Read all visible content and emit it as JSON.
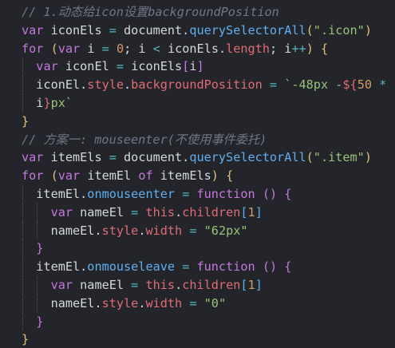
{
  "editor": {
    "lines": [
      [
        {
          "t": "// 1.动态给icon设置backgroundPosition",
          "c": "comment"
        }
      ],
      [
        {
          "t": "var",
          "c": "keyword"
        },
        {
          "t": " iconEls ",
          "c": "plain"
        },
        {
          "t": "=",
          "c": "op"
        },
        {
          "t": " document.",
          "c": "plain"
        },
        {
          "t": "querySelectorAll",
          "c": "method"
        },
        {
          "t": "(",
          "c": "bracket-gold"
        },
        {
          "t": "\".icon\"",
          "c": "string"
        },
        {
          "t": ")",
          "c": "bracket-gold"
        }
      ],
      [
        {
          "t": "for",
          "c": "keyword"
        },
        {
          "t": " ",
          "c": "plain"
        },
        {
          "t": "(",
          "c": "bracket-gold"
        },
        {
          "t": "var",
          "c": "keyword"
        },
        {
          "t": " i ",
          "c": "plain"
        },
        {
          "t": "=",
          "c": "op"
        },
        {
          "t": " ",
          "c": "plain"
        },
        {
          "t": "0",
          "c": "number"
        },
        {
          "t": "; i ",
          "c": "plain"
        },
        {
          "t": "<",
          "c": "op"
        },
        {
          "t": " iconEls.",
          "c": "plain"
        },
        {
          "t": "length",
          "c": "builtin"
        },
        {
          "t": "; i",
          "c": "plain"
        },
        {
          "t": "++",
          "c": "op"
        },
        {
          "t": ")",
          "c": "bracket-gold"
        },
        {
          "t": " ",
          "c": "plain"
        },
        {
          "t": "{",
          "c": "bracket-gold"
        }
      ],
      [
        {
          "t": "  ",
          "c": "plain"
        },
        {
          "t": "var",
          "c": "keyword"
        },
        {
          "t": " iconEl ",
          "c": "plain"
        },
        {
          "t": "=",
          "c": "op"
        },
        {
          "t": " iconEls",
          "c": "plain"
        },
        {
          "t": "[",
          "c": "bracket-purple"
        },
        {
          "t": "i",
          "c": "plain"
        },
        {
          "t": "]",
          "c": "bracket-purple"
        }
      ],
      [
        {
          "t": "  iconEl.",
          "c": "plain"
        },
        {
          "t": "style",
          "c": "builtin"
        },
        {
          "t": ".",
          "c": "plain"
        },
        {
          "t": "backgroundPosition",
          "c": "builtin"
        },
        {
          "t": " ",
          "c": "plain"
        },
        {
          "t": "=",
          "c": "op"
        },
        {
          "t": " ",
          "c": "plain"
        },
        {
          "t": "`-48px -",
          "c": "template"
        },
        {
          "t": "${",
          "c": "template-expr"
        },
        {
          "t": "50",
          "c": "number"
        },
        {
          "t": " ",
          "c": "plain"
        },
        {
          "t": "*",
          "c": "op"
        }
      ],
      [
        {
          "t": "  i",
          "c": "plain"
        },
        {
          "t": "}",
          "c": "template-expr"
        },
        {
          "t": "px`",
          "c": "template"
        }
      ],
      [
        {
          "t": "}",
          "c": "bracket-gold"
        }
      ],
      [
        {
          "t": "// 方案一: mouseenter(不使用事件委托)",
          "c": "comment"
        }
      ],
      [
        {
          "t": "var",
          "c": "keyword"
        },
        {
          "t": " itemEls ",
          "c": "plain"
        },
        {
          "t": "=",
          "c": "op"
        },
        {
          "t": " document.",
          "c": "plain"
        },
        {
          "t": "querySelectorAll",
          "c": "method"
        },
        {
          "t": "(",
          "c": "bracket-gold"
        },
        {
          "t": "\".item\"",
          "c": "string"
        },
        {
          "t": ")",
          "c": "bracket-gold"
        }
      ],
      [
        {
          "t": "for",
          "c": "keyword"
        },
        {
          "t": " ",
          "c": "plain"
        },
        {
          "t": "(",
          "c": "bracket-gold"
        },
        {
          "t": "var",
          "c": "keyword"
        },
        {
          "t": " itemEl ",
          "c": "plain"
        },
        {
          "t": "of",
          "c": "keyword"
        },
        {
          "t": " itemEls",
          "c": "plain"
        },
        {
          "t": ")",
          "c": "bracket-gold"
        },
        {
          "t": " ",
          "c": "plain"
        },
        {
          "t": "{",
          "c": "bracket-gold"
        }
      ],
      [
        {
          "t": "  itemEl.",
          "c": "plain"
        },
        {
          "t": "onmouseenter",
          "c": "method"
        },
        {
          "t": " ",
          "c": "plain"
        },
        {
          "t": "=",
          "c": "op"
        },
        {
          "t": " ",
          "c": "plain"
        },
        {
          "t": "function",
          "c": "keyword"
        },
        {
          "t": " ",
          "c": "plain"
        },
        {
          "t": "()",
          "c": "bracket-purple"
        },
        {
          "t": " ",
          "c": "plain"
        },
        {
          "t": "{",
          "c": "bracket-purple"
        }
      ],
      [
        {
          "t": "    ",
          "c": "plain"
        },
        {
          "t": "var",
          "c": "keyword"
        },
        {
          "t": " nameEl ",
          "c": "plain"
        },
        {
          "t": "=",
          "c": "op"
        },
        {
          "t": " ",
          "c": "plain"
        },
        {
          "t": "this",
          "c": "builtin"
        },
        {
          "t": ".",
          "c": "plain"
        },
        {
          "t": "children",
          "c": "builtin"
        },
        {
          "t": "[",
          "c": "bracket-blue"
        },
        {
          "t": "1",
          "c": "number"
        },
        {
          "t": "]",
          "c": "bracket-blue"
        }
      ],
      [
        {
          "t": "    nameEl.",
          "c": "plain"
        },
        {
          "t": "style",
          "c": "builtin"
        },
        {
          "t": ".",
          "c": "plain"
        },
        {
          "t": "width",
          "c": "builtin"
        },
        {
          "t": " ",
          "c": "plain"
        },
        {
          "t": "=",
          "c": "op"
        },
        {
          "t": " ",
          "c": "plain"
        },
        {
          "t": "\"62px\"",
          "c": "string"
        }
      ],
      [
        {
          "t": "  ",
          "c": "plain"
        },
        {
          "t": "}",
          "c": "bracket-purple"
        }
      ],
      [
        {
          "t": "  itemEl.",
          "c": "plain"
        },
        {
          "t": "onmouseleave",
          "c": "method"
        },
        {
          "t": " ",
          "c": "plain"
        },
        {
          "t": "=",
          "c": "op"
        },
        {
          "t": " ",
          "c": "plain"
        },
        {
          "t": "function",
          "c": "keyword"
        },
        {
          "t": " ",
          "c": "plain"
        },
        {
          "t": "()",
          "c": "bracket-purple"
        },
        {
          "t": " ",
          "c": "plain"
        },
        {
          "t": "{",
          "c": "bracket-purple"
        }
      ],
      [
        {
          "t": "    ",
          "c": "plain"
        },
        {
          "t": "var",
          "c": "keyword"
        },
        {
          "t": " nameEl ",
          "c": "plain"
        },
        {
          "t": "=",
          "c": "op"
        },
        {
          "t": " ",
          "c": "plain"
        },
        {
          "t": "this",
          "c": "builtin"
        },
        {
          "t": ".",
          "c": "plain"
        },
        {
          "t": "children",
          "c": "builtin"
        },
        {
          "t": "[",
          "c": "bracket-blue"
        },
        {
          "t": "1",
          "c": "number"
        },
        {
          "t": "]",
          "c": "bracket-blue"
        }
      ],
      [
        {
          "t": "    nameEl.",
          "c": "plain"
        },
        {
          "t": "style",
          "c": "builtin"
        },
        {
          "t": ".",
          "c": "plain"
        },
        {
          "t": "width",
          "c": "builtin"
        },
        {
          "t": " ",
          "c": "plain"
        },
        {
          "t": "=",
          "c": "op"
        },
        {
          "t": " ",
          "c": "plain"
        },
        {
          "t": "\"0\"",
          "c": "string"
        }
      ],
      [
        {
          "t": "  ",
          "c": "plain"
        },
        {
          "t": "}",
          "c": "bracket-purple"
        }
      ],
      [
        {
          "t": "}",
          "c": "bracket-gold"
        }
      ]
    ]
  }
}
